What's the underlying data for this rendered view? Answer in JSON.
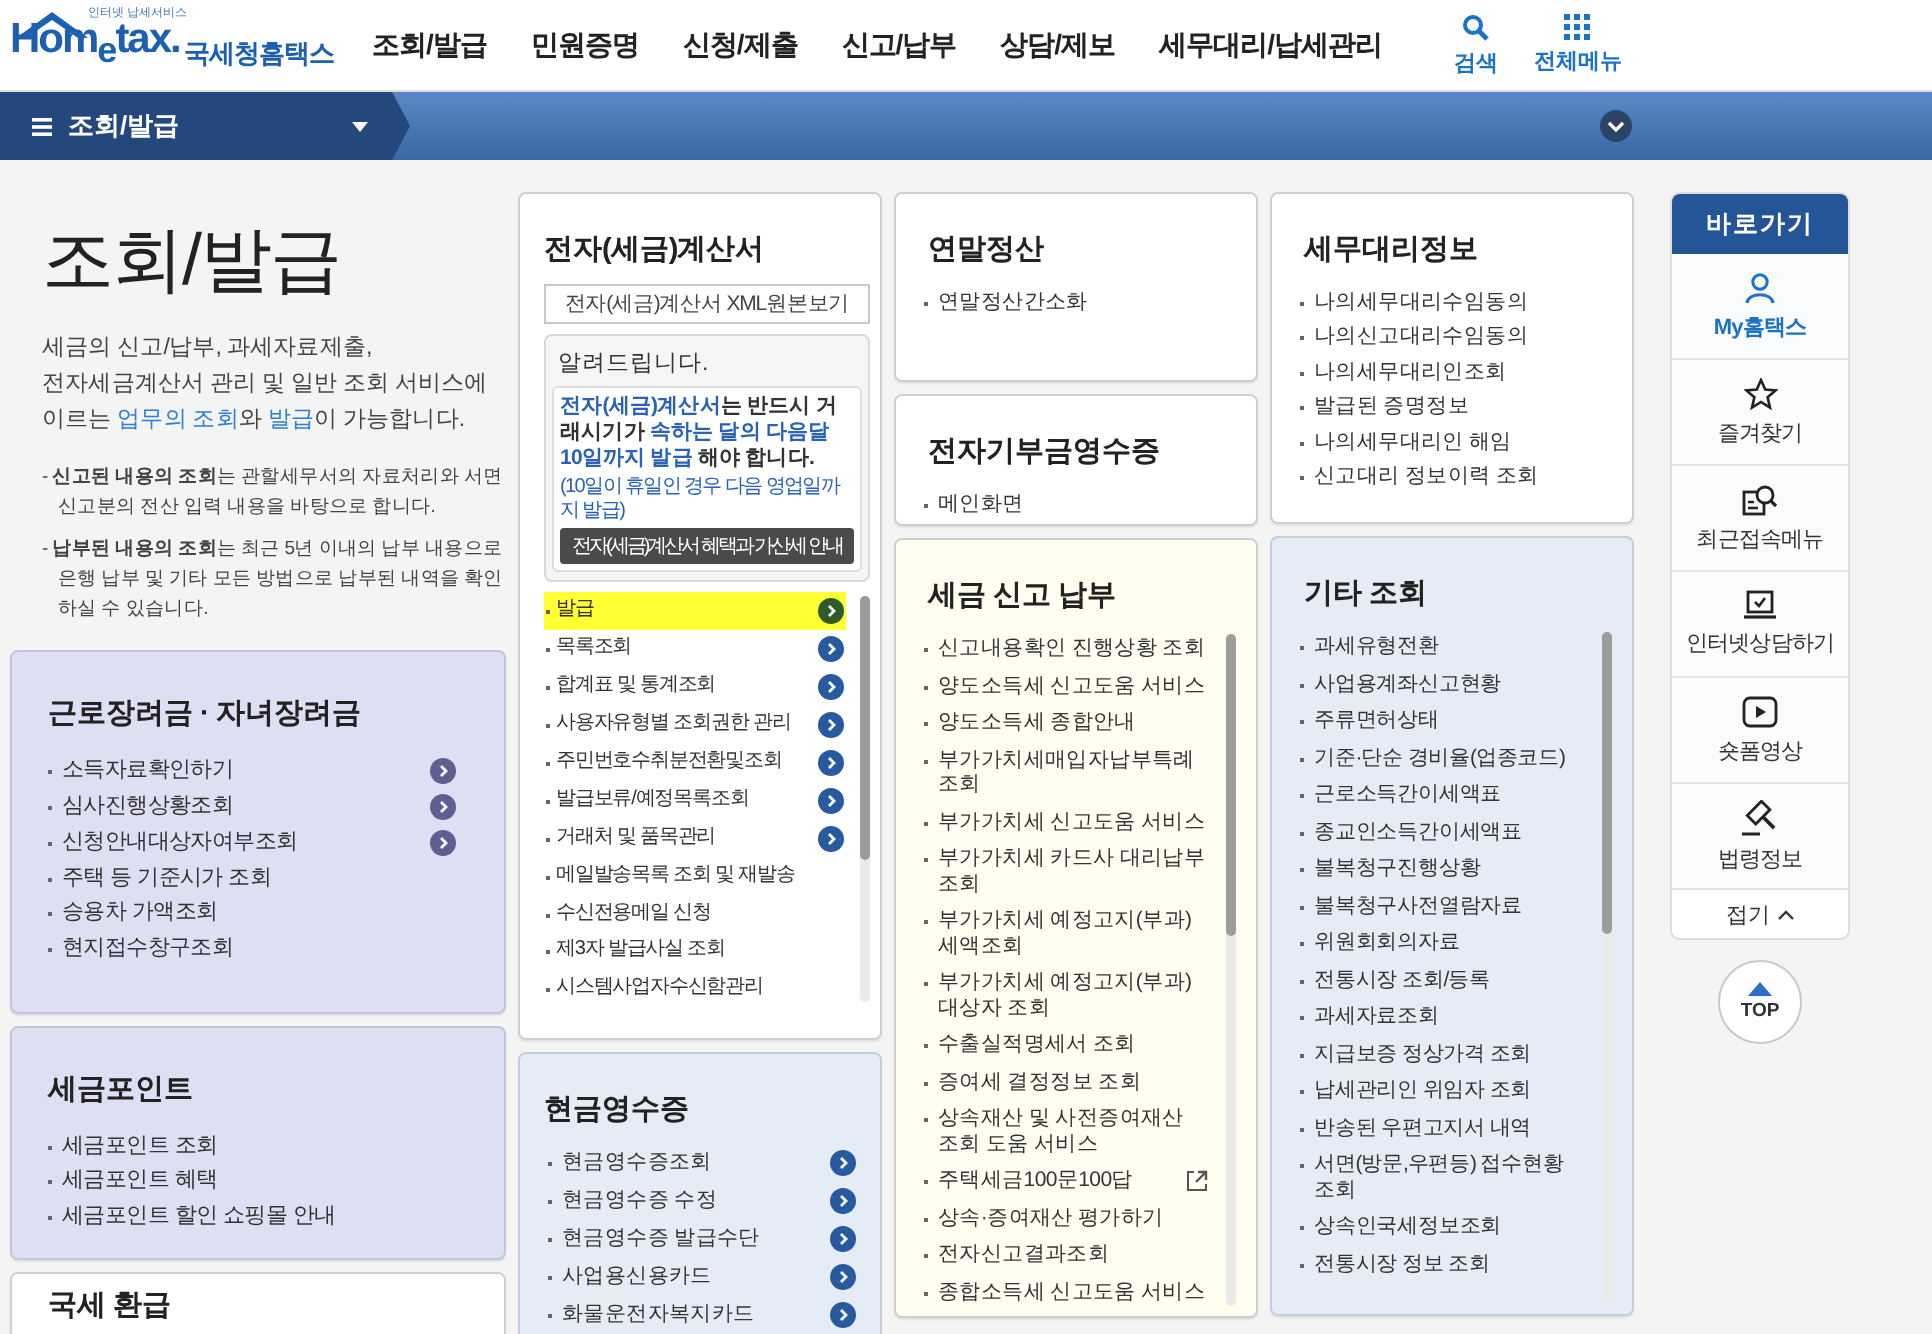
{
  "header": {
    "logo": {
      "tagline": "인터넷 납세서비스",
      "brand": "Hom$_{e}$tax.",
      "name": "국세청홈택스"
    },
    "nav": [
      "조회/발급",
      "민원증명",
      "신청/제출",
      "신고/납부",
      "상담/제보",
      "세무대리/납세관리"
    ],
    "tools": [
      {
        "kind": "search",
        "label": "검색"
      },
      {
        "kind": "grid",
        "label": "전체메뉴"
      }
    ]
  },
  "menu_bar": {
    "current": "조회/발급"
  },
  "intro": {
    "title": "조회/발급",
    "description": [
      [
        {
          "text": "세금의 신고/납부, 과세자료제출,",
          "emphasis": false
        }
      ],
      [
        {
          "text": "전자세금계산서 관리 및 일반 조회 서비스에",
          "emphasis": false
        }
      ],
      [
        {
          "text": "이르는 ",
          "emphasis": false
        },
        {
          "text": "업무의 조회",
          "emphasis": true
        },
        {
          "text": "와 ",
          "emphasis": false
        },
        {
          "text": "발급",
          "emphasis": true
        },
        {
          "text": "이 가능합니다.",
          "emphasis": false
        }
      ]
    ],
    "notes": [
      "- **신고된 내용의 조회**는 관할세무서의 자료처리와 서면신고분의 전산 입력 내용을 바탕으로 합니다.",
      "- **납부된 내용의 조회**는 최근 5년 이내의 납부 내용으로 은행 납부 및 기타 모든 방법으로 납부된 내역을 확인하실 수 있습니다."
    ]
  },
  "columns": [
    {
      "cards": [
        {
          "kind": "links",
          "color": "#dedff2",
          "title": "근로장려금 · 자녀장려금",
          "scroll": false,
          "items": [
            {
              "label": "소득자료확인하기",
              "arrow": true
            },
            {
              "label": "심사진행상황조회",
              "arrow": true
            },
            {
              "label": "신청안내대상자여부조회",
              "arrow": true
            },
            {
              "label": "주택 등 기준시가 조회",
              "arrow": false
            },
            {
              "label": "승용차 가액조회",
              "arrow": false
            },
            {
              "label": "현지접수창구조회",
              "arrow": false
            }
          ]
        },
        {
          "kind": "links",
          "color": "#dedff2",
          "title": "세금포인트",
          "scroll": false,
          "items": [
            {
              "label": "세금포인트 조회"
            },
            {
              "label": "세금포인트 혜택"
            },
            {
              "label": "세금포인트 할인 쇼핑몰 안내"
            }
          ]
        },
        {
          "kind": "links",
          "color": "#ffffff",
          "title": "국세 환급"
        }
      ]
    },
    {
      "cards": [
        {
          "kind": "invoice",
          "color": "#ffffff",
          "title": "전자(세금)계산서",
          "scroll": true,
          "button": "전자(세금)계산서 XML원본보기",
          "notice": {
            "heading": "알려드립니다.",
            "message": [
              {
                "text": "전자(세금)계산서",
                "emphasis": true
              },
              {
                "text": "는 반드시 거래시기가 ",
                "emphasis": false
              },
              {
                "text": "속하는 달의 다음달 10일까지 발급",
                "emphasis": true
              },
              {
                "text": " 해야 합니다.",
                "emphasis": false
              }
            ],
            "footnote": "(10일이 휴일인 경우 다음 영업일까지 발급)",
            "link": "전자(세금)계산서 혜택과 가산세 안내"
          },
          "items": [
            {
              "label": "발급",
              "arrow": true,
              "highlighted": true
            },
            {
              "label": "목록조회",
              "arrow": true,
              "highlighted": false
            },
            {
              "label": "합계표 및 통계조회",
              "arrow": true,
              "highlighted": false
            },
            {
              "label": "사용자유형별 조회권한 관리",
              "arrow": true,
              "highlighted": false
            },
            {
              "label": "주민번호수취분전환및조회",
              "arrow": true,
              "highlighted": false
            },
            {
              "label": "발급보류/예정목록조회",
              "arrow": true,
              "highlighted": false
            },
            {
              "label": "거래처 및 품목관리",
              "arrow": true,
              "highlighted": false
            },
            {
              "label": "메일발송목록 조회 및 재발송",
              "arrow": false,
              "highlighted": false
            },
            {
              "label": "수신전용메일 신청",
              "arrow": false,
              "highlighted": false
            },
            {
              "label": "제3자 발급사실 조회",
              "arrow": false,
              "highlighted": false
            },
            {
              "label": "시스템사업자수신함관리",
              "arrow": false,
              "highlighted": false
            }
          ]
        },
        {
          "kind": "links",
          "color": "#e5ecf5",
          "title": "현금영수증",
          "scroll": false,
          "items": [
            {
              "label": "현금영수증조회",
              "arrow": true
            },
            {
              "label": "현금영수증 수정",
              "arrow": true
            },
            {
              "label": "현금영수증 발급수단",
              "arrow": true
            },
            {
              "label": "사업용신용카드",
              "arrow": true
            },
            {
              "label": "화물운전자복지카드",
              "arrow": true
            }
          ]
        }
      ]
    },
    {
      "cards": [
        {
          "kind": "links",
          "color": "#ffffff",
          "title": "연말정산",
          "scroll": false,
          "items": [
            {
              "label": "연말정산간소화"
            }
          ]
        },
        {
          "kind": "links",
          "color": "#ffffff",
          "title": "전자기부금영수증",
          "scroll": false,
          "items": [
            {
              "label": "메인화면"
            }
          ]
        },
        {
          "kind": "links",
          "color": "#fefdf0",
          "title": "세금 신고 납부",
          "scroll": true,
          "items": [
            {
              "label": "신고내용확인 진행상황 조회"
            },
            {
              "label": "양도소득세 신고도움 서비스"
            },
            {
              "label": "양도소득세 종합안내"
            },
            {
              "label": "부가가치세매입자납부특례조회"
            },
            {
              "label": "부가가치세 신고도움 서비스"
            },
            {
              "label": "부가가치세 카드사 대리납부 조회"
            },
            {
              "label": "부가가치세 예정고지(부과) 세액조회"
            },
            {
              "label": "부가가치세 예정고지(부과) 대상자 조회"
            },
            {
              "label": "수출실적명세서 조회"
            },
            {
              "label": "증여세 결정정보 조회"
            },
            {
              "label": "상속재산 및 사전증여재산 조회 도움 서비스"
            },
            {
              "label": "주택세금100문100답",
              "external": true
            },
            {
              "label": "상속·증여재산 평가하기"
            },
            {
              "label": "전자신고결과조회"
            },
            {
              "label": "종합소득세 신고도움 서비스"
            }
          ]
        }
      ]
    },
    {
      "cards": [
        {
          "kind": "links",
          "color": "#ffffff",
          "title": "세무대리정보",
          "scroll": false,
          "items": [
            {
              "label": "나의세무대리수임동의"
            },
            {
              "label": "나의신고대리수임동의"
            },
            {
              "label": "나의세무대리인조회"
            },
            {
              "label": "발급된 증명정보"
            },
            {
              "label": "나의세무대리인 해임"
            },
            {
              "label": "신고대리 정보이력 조회"
            }
          ]
        },
        {
          "kind": "links",
          "color": "#e5ecf5",
          "title": "기타 조회",
          "scroll": true,
          "items": [
            {
              "label": "과세유형전환"
            },
            {
              "label": "사업용계좌신고현황"
            },
            {
              "label": "주류면허상태"
            },
            {
              "label": "기준·단순 경비율(업종코드)"
            },
            {
              "label": "근로소득간이세액표"
            },
            {
              "label": "종교인소득간이세액표"
            },
            {
              "label": "불복청구진행상황"
            },
            {
              "label": "불복청구사전열람자료"
            },
            {
              "label": "위원회회의자료"
            },
            {
              "label": "전통시장 조회/등록"
            },
            {
              "label": "과세자료조회"
            },
            {
              "label": "지급보증 정상가격 조회"
            },
            {
              "label": "납세관리인 위임자 조회"
            },
            {
              "label": "반송된 우편고지서 내역"
            },
            {
              "label": "서면(방문,우편등) 접수현황조회"
            },
            {
              "label": "상속인국세정보조회"
            },
            {
              "label": "전통시장 정보 조회"
            }
          ]
        }
      ]
    }
  ],
  "shortcuts": {
    "title": "바로가기",
    "items": [
      {
        "kind": "person",
        "label": "My홈택스",
        "accent": true
      },
      {
        "kind": "star",
        "label": "즐겨찾기",
        "accent": false
      },
      {
        "kind": "recent",
        "label": "최근접속메뉴",
        "accent": false
      },
      {
        "kind": "laptop",
        "label": "인터넷상담하기",
        "accent": false
      },
      {
        "kind": "video",
        "label": "숏폼영상",
        "accent": false
      },
      {
        "kind": "gavel",
        "label": "법령정보",
        "accent": false
      }
    ],
    "collapse": "접기"
  },
  "top_button": "TOP"
}
